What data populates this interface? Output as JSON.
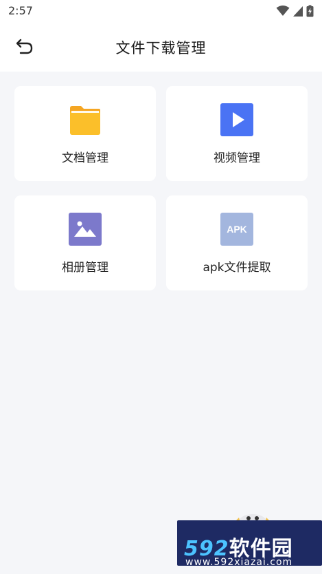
{
  "status_bar": {
    "time": "2:57"
  },
  "header": {
    "title": "文件下载管理"
  },
  "cards": [
    {
      "label": "文档管理",
      "icon": "folder-icon",
      "color": "#FBBF2A"
    },
    {
      "label": "视频管理",
      "icon": "play-video-icon",
      "color": "#4A73F4"
    },
    {
      "label": "相册管理",
      "icon": "image-gallery-icon",
      "color": "#7C79CB"
    },
    {
      "label": "apk文件提取",
      "icon": "apk-icon",
      "color": "#A3B6DE",
      "icon_text": "APK"
    }
  ],
  "watermark": {
    "brand_number": "592",
    "brand_text": "软件园",
    "url": "www.592xiazai.com"
  }
}
